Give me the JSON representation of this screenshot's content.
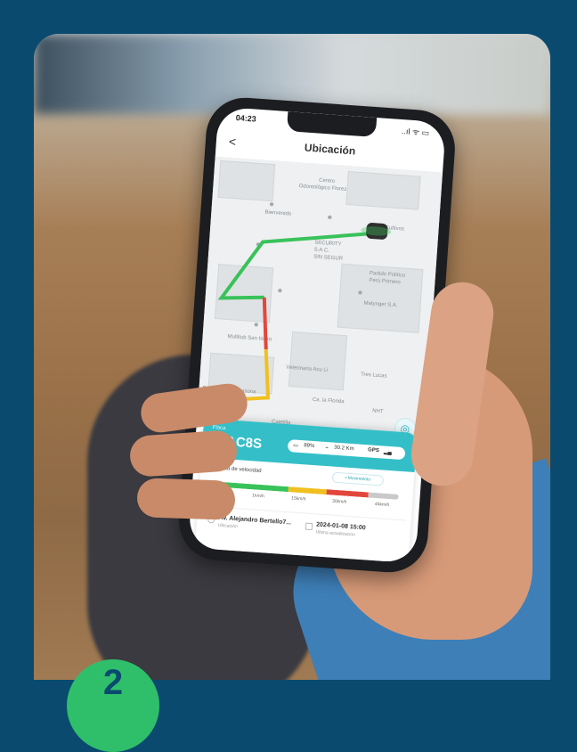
{
  "colors": {
    "frame": "#0a4a6e",
    "accent": "#34bfc8",
    "badge": "#2fbf6a",
    "route_green": "#39c25a",
    "route_red": "#e2473c",
    "route_yellow": "#f0c020"
  },
  "status_bar": {
    "time": "04:23",
    "icons": "..ıl ᯤ ▭"
  },
  "header": {
    "back": "<",
    "title": "Ubicación"
  },
  "map": {
    "labels": [
      "Centro",
      "Odontológico Florez",
      "Bienvenido",
      "Cultivos",
      "SECURITY",
      "S.A.C.",
      "SIN SEGUR",
      "Partido Político",
      "Perú Primero",
      "Matynger S.A.",
      "Multitub San Isidro",
      "Veterinaria Acu Li",
      "Tres Lucas",
      "Ca. la Florida",
      "Restaurant La Casona",
      "NHT",
      "Cajetilla"
    ]
  },
  "panel": {
    "placa_label": "Placa",
    "placa": "48AC8S",
    "battery": "89%",
    "speed": "30.2 Km",
    "gps": "GPS",
    "legend_title": "Leyenda de velocidad",
    "movement": "• Movimiento",
    "ticks": [
      "0",
      "1km/h",
      "15km/h",
      "30km/h",
      "45km/h"
    ],
    "address": "Av. Alejandro Bertello7...",
    "address_sub": "Ubicación",
    "date": "2024-01-08 15:00",
    "date_sub": "Última actualización"
  },
  "speed_legend": {
    "segments": [
      {
        "color": "#39c25a",
        "fraction": 0.42
      },
      {
        "color": "#f0c020",
        "fraction": 0.2
      },
      {
        "color": "#e2473c",
        "fraction": 0.22
      },
      {
        "color": "#c9c9c9",
        "fraction": 0.16
      }
    ]
  },
  "badge": {
    "number": "2"
  }
}
